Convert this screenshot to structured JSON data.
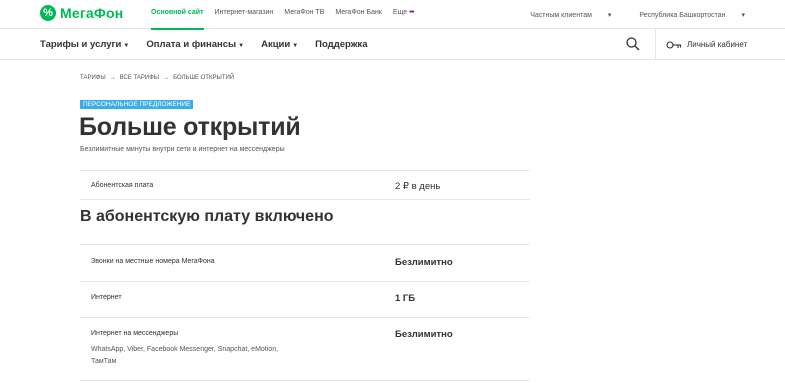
{
  "brand": {
    "name": "МегаФон",
    "color": "#00b956",
    "accent": "#731982"
  },
  "topnav": {
    "links": [
      "Основной сайт",
      "Интернет-магазин",
      "МегаФон ТВ",
      "МегаФон Банк",
      "Еще"
    ],
    "active_index": 0,
    "more_dots": "•••",
    "segment": "Частным клиентам",
    "region": "Республика Башкортостан"
  },
  "mainnav": {
    "items": [
      "Тарифы и услуги",
      "Оплата и финансы",
      "Акции",
      "Поддержка"
    ],
    "search_icon": "search-icon",
    "cabinet_icon": "key-icon",
    "cabinet_label": "Личный кабинет"
  },
  "breadcrumb": [
    "Тарифы",
    "Все тарифы",
    "Больше открытий"
  ],
  "badge": "Персональное предложение",
  "badge_color": "#3baee5",
  "title": "Больше открытий",
  "subtitle": "Безлимитные минуты внутри сети и интернет на мессенджеры",
  "fee": {
    "label": "Абонентская плата",
    "value": "2 ₽ в день"
  },
  "included_title": "В абонентскую плату включено",
  "included": [
    {
      "label": "Звонки на местные номера МегаФона",
      "value": "Безлимитно"
    },
    {
      "label": "Интернет",
      "value": "1 ГБ"
    },
    {
      "label": "Интернет на мессенджеры",
      "value": "Безлимитно",
      "note": "WhatsApp, Viber, Facebook Messenger, Snapchat, eMotion, ТамТам"
    }
  ]
}
